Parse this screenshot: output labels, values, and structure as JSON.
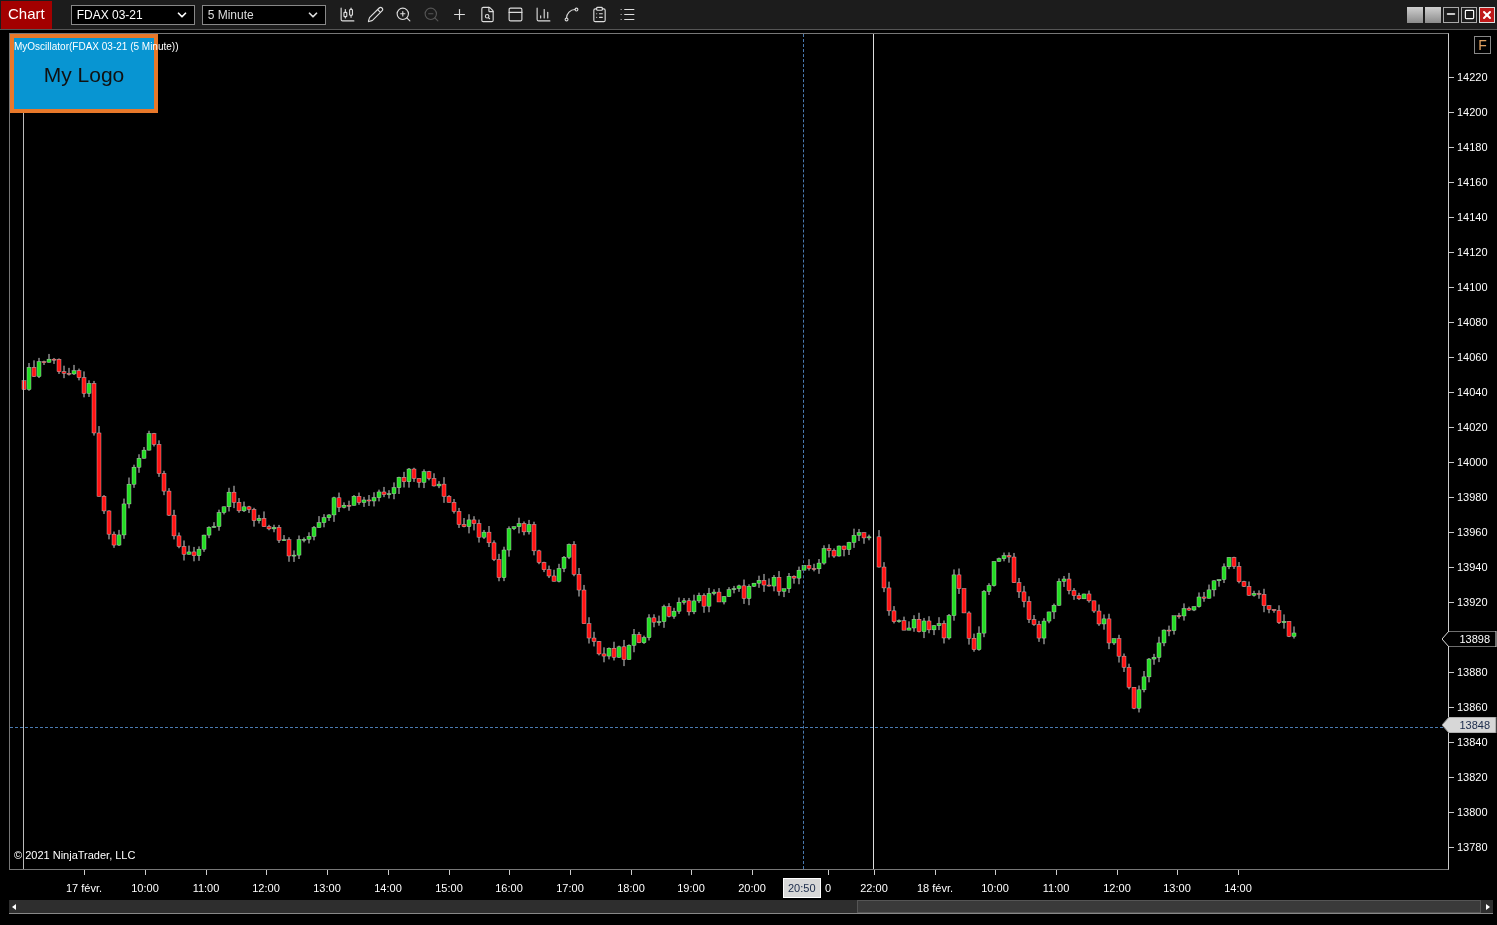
{
  "toolbar": {
    "title": "Chart",
    "instrument": "FDAX 03-21",
    "interval": "5 Minute",
    "tools": [
      {
        "kind": "candles",
        "disabled": false
      },
      {
        "kind": "pencil",
        "disabled": false
      },
      {
        "kind": "zoom-in",
        "disabled": false
      },
      {
        "kind": "zoom-out",
        "disabled": true
      },
      {
        "kind": "crosshair",
        "disabled": false
      },
      {
        "kind": "data-box",
        "disabled": false
      },
      {
        "kind": "properties",
        "disabled": false
      },
      {
        "kind": "bars",
        "disabled": false
      },
      {
        "kind": "strategy",
        "disabled": false
      },
      {
        "kind": "template",
        "disabled": false
      },
      {
        "kind": "list",
        "disabled": false
      }
    ]
  },
  "window_buttons": [
    {
      "kind": "tile"
    },
    {
      "kind": "tile"
    },
    {
      "kind": "minimize"
    },
    {
      "kind": "maximize"
    },
    {
      "kind": "close"
    }
  ],
  "chart": {
    "indicator_label": "MyOscillator(FDAX 03-21 (5 Minute))",
    "logo": "My Logo",
    "copyright": "© 2021 NinjaTrader, LLC",
    "f_button": "F",
    "y_axis": [
      "14220",
      "14200",
      "14180",
      "14160",
      "14140",
      "14120",
      "14100",
      "14080",
      "14060",
      "14040",
      "14020",
      "14000",
      "13980",
      "13960",
      "13940",
      "13920",
      "13880",
      "13860",
      "13840",
      "13820",
      "13800",
      "13780"
    ],
    "price_markers": [
      {
        "label": "13898",
        "kind": "last"
      },
      {
        "label": "13848",
        "kind": "cursor"
      }
    ],
    "x_axis": [
      "17 févr.",
      "10:00",
      "11:00",
      "12:00",
      "13:00",
      "14:00",
      "15:00",
      "16:00",
      "17:00",
      "18:00",
      "19:00",
      "20:00",
      "0",
      "22:00",
      "18 févr.",
      "10:00",
      "11:00",
      "12:00",
      "13:00",
      "14:00"
    ],
    "cursor_time": "20:50"
  }
}
